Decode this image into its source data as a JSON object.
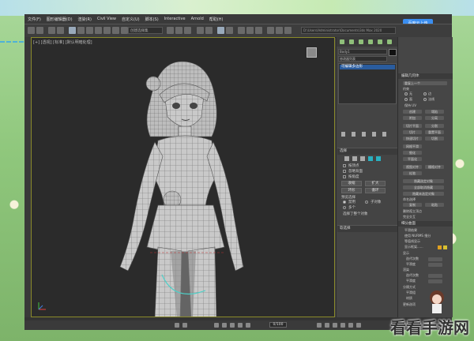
{
  "menubar": {
    "items": [
      "文件(F)",
      "图形编辑器(D)",
      "渲染(R)",
      "Civil View",
      "自定义(U)",
      "脚本(S)",
      "Interactive",
      "Arnold",
      "帮助(H)"
    ]
  },
  "cloud_button": "百度云上传",
  "toolbar": {
    "selection_set_placeholder": "创建选择集",
    "path_text": "D:\\Users\\Administrator\\Documents\\3ds Max 2020"
  },
  "viewport": {
    "label": "[+] [透视] [标准] [默认明暗处理]"
  },
  "command_panel": {
    "object_name": "Body1",
    "modifier_list": "修改器列表",
    "stack_item": "可编辑多边形",
    "selection_rollout": "选择",
    "by_vertex": "按顶点",
    "ignore_backfacing": "忽略背面",
    "by_angle": "按角度",
    "shrink": "收缩",
    "grow": "扩大",
    "ring": "环形",
    "loop": "循环",
    "preview_selection": "预览选择",
    "disabled": "禁用",
    "subobject": "子对象",
    "multi": "多个",
    "whole_object_selected": "选择了整个对象",
    "soft_selection_rollout": "软选择"
  },
  "edit_panel": {
    "title": "编辑几何体",
    "repeat_last": "重复上一个",
    "constraints": "约束",
    "none": "无",
    "edge": "边",
    "face": "面",
    "normal": "法线",
    "preserve_uvs": "保持 UV",
    "create": "创建",
    "collapse": "塌陷",
    "attach": "附加",
    "detach": "分离",
    "slice_plane": "切片平面",
    "split": "分割",
    "slice": "切片",
    "reset_plane": "重置平面",
    "quickslice": "快速切片",
    "cut": "切割",
    "meshsmooth": "网格平滑",
    "tessellate": "细化",
    "make_planar": "平面化",
    "view_align": "视图对齐",
    "grid_align": "栅格对齐",
    "relax": "松弛",
    "hide_selected": "隐藏选定对象",
    "unhide_all": "全部取消隐藏",
    "hide_unselected": "隐藏未选定对象",
    "named_selections": "命名选择",
    "copy": "复制",
    "paste": "粘贴",
    "delete_isolated_vertices": "删除孤立顶点",
    "full_interactivity": "完全交互",
    "subdivision_surface": "细分曲面",
    "smooth_result": "平滑结果",
    "use_nurms": "使用 NURMS 细分",
    "isoline_display": "等值线显示",
    "show_cage": "显示框架......",
    "display": "显示",
    "iterations": "迭代次数",
    "smoothness": "平滑度",
    "render": "渲染",
    "separate_by": "分隔方式",
    "smoothing_groups": "平滑组",
    "materials": "材质",
    "update_options": "更新选项",
    "cage_color_1": "#e0a020",
    "cage_color_2": "#d8c030"
  },
  "timeline": {
    "frame": "0/100"
  },
  "watermark": "看看手游网"
}
